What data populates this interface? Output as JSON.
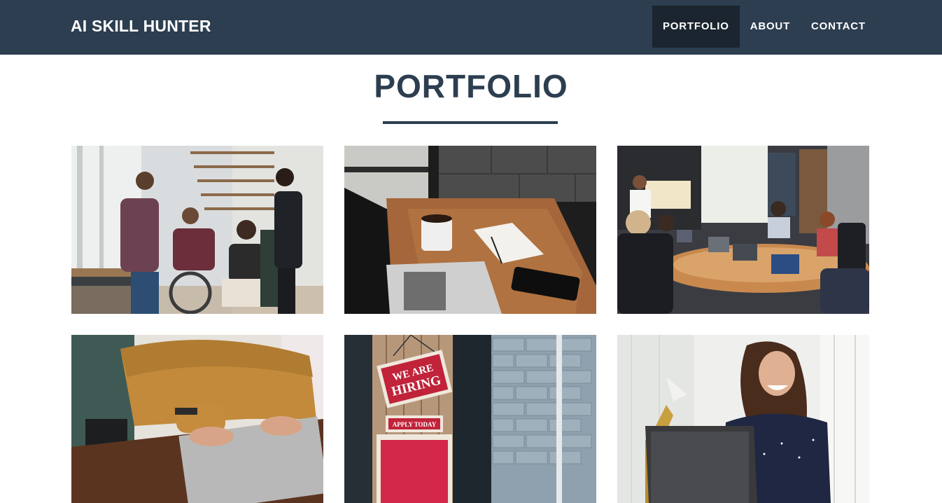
{
  "navbar": {
    "brand": "AI SKILL HUNTER",
    "items": [
      {
        "label": "PORTFOLIO",
        "active": true
      },
      {
        "label": "ABOUT",
        "active": false
      },
      {
        "label": "CONTACT",
        "active": false
      }
    ]
  },
  "main": {
    "title": "PORTFOLIO",
    "portfolio_items": [
      {
        "image": "office-team-meeting-photo"
      },
      {
        "image": "laptop-coffee-desk-photo"
      },
      {
        "image": "conference-room-presentation-photo"
      },
      {
        "image": "person-typing-laptop-photo"
      },
      {
        "image": "we-are-hiring-sign-photo",
        "sign_lines": [
          "WE ARE",
          "HIRING"
        ],
        "sign_subtext": "APPLY TODAY"
      },
      {
        "image": "smiling-woman-laptop-photo"
      }
    ]
  },
  "colors": {
    "navbar_bg": "#2c3e50",
    "nav_active_bg": "#1a252f",
    "title_color": "#2c3e50",
    "background": "#ffffff"
  }
}
